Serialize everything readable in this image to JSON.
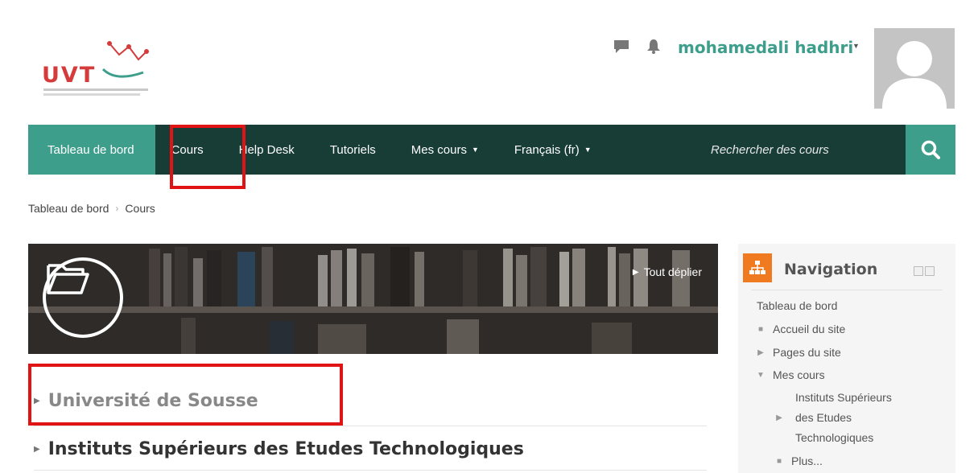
{
  "header": {
    "logo_text": "UVT",
    "username": "mohamedali hadhri",
    "icons": [
      "message-icon",
      "bell-icon"
    ]
  },
  "navbar": {
    "items": [
      {
        "label": "Tableau de bord",
        "active": true
      },
      {
        "label": "Cours"
      },
      {
        "label": "Help Desk"
      },
      {
        "label": "Tutoriels"
      },
      {
        "label": "Mes cours",
        "dropdown": true
      },
      {
        "label": "Français (fr)",
        "dropdown": true
      }
    ],
    "search_placeholder": "Rechercher des cours",
    "accent_color": "#3e9e8c",
    "bar_color": "#173d36"
  },
  "breadcrumb": [
    "Tableau de bord",
    "Cours"
  ],
  "banner": {
    "expand_all": "Tout déplier"
  },
  "categories": [
    {
      "label": "Université de Sousse"
    },
    {
      "label": "Instituts Supérieurs des Etudes Technologiques"
    }
  ],
  "navigation_block": {
    "title": "Navigation",
    "items": [
      {
        "label": "Tableau de bord"
      },
      {
        "label": "Accueil du site"
      },
      {
        "label": "Pages du site"
      },
      {
        "label": "Mes cours"
      },
      {
        "label_lines": [
          "Instituts Supérieurs",
          "des Etudes",
          "Technologiques"
        ]
      },
      {
        "label": "Plus..."
      }
    ]
  },
  "highlight_color": "#e01414"
}
